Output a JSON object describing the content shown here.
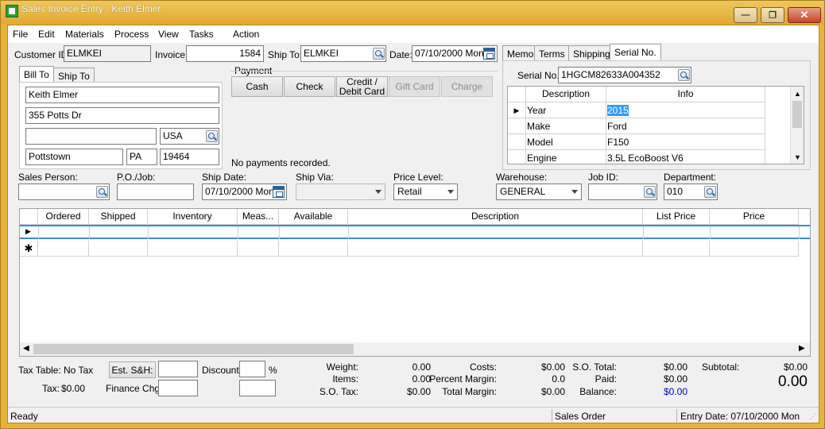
{
  "window": {
    "title": "Sales Invoice Entry - Keith Elmer"
  },
  "menu": [
    "File",
    "Edit",
    "Materials",
    "Process",
    "View",
    "Tasks",
    "Action"
  ],
  "header": {
    "customer_id_label": "Customer ID:",
    "customer_id": "ELMKEI",
    "invoice_label": "Invoice:",
    "invoice": "1584",
    "ship_to_label": "Ship To:",
    "ship_to": "ELMKEI",
    "date_label": "Date:",
    "date": "07/10/2000 Mon"
  },
  "address_tabs": [
    "Bill To",
    "Ship To"
  ],
  "bill_to": {
    "name": "Keith Elmer",
    "address1": "355 Potts Dr",
    "address2": "",
    "country": "USA",
    "city": "Pottstown",
    "state": "PA",
    "zip": "19464"
  },
  "payment": {
    "label": "Payment",
    "buttons": [
      "Cash",
      "Check",
      "Credit /\nDebit Card",
      "Gift Card",
      "Charge"
    ],
    "status": "No payments recorded."
  },
  "side_tabs": [
    "Memo",
    "Terms",
    "Shipping",
    "Serial No."
  ],
  "serial": {
    "label": "Serial No.",
    "value": "1HGCM82633A004352",
    "columns": [
      "Description",
      "Info"
    ],
    "rows": [
      {
        "desc": "Year",
        "info": "2015"
      },
      {
        "desc": "Make",
        "info": "Ford"
      },
      {
        "desc": "Model",
        "info": "F150"
      },
      {
        "desc": "Engine",
        "info": "3.5L EcoBoost V6"
      }
    ]
  },
  "order_fields": {
    "sales_person_label": "Sales Person:",
    "sales_person": "",
    "po_job_label": "P.O./Job:",
    "po_job": "",
    "ship_date_label": "Ship Date:",
    "ship_date": "07/10/2000 Mon",
    "ship_via_label": "Ship Via:",
    "ship_via": "",
    "price_level_label": "Price Level:",
    "price_level": "Retail",
    "warehouse_label": "Warehouse:",
    "warehouse": "GENERAL",
    "job_id_label": "Job ID:",
    "job_id": "",
    "department_label": "Department:",
    "department": "010"
  },
  "grid": {
    "columns": [
      "Ordered",
      "Shipped",
      "Inventory",
      "Meas...",
      "Available",
      "Description",
      "List Price",
      "Price"
    ]
  },
  "totals": {
    "tax_table_label": "Tax Table:",
    "tax_table": "No Tax",
    "tax_label": "Tax:",
    "tax": "$0.00",
    "est_sh_button": "Est. S&H:",
    "finance_chg_label": "Finance Chg:",
    "discount_label": "Discount:",
    "percent_sign": "%",
    "weight_label": "Weight:",
    "weight": "0.00",
    "items_label": "Items:",
    "items": "0.00",
    "so_tax_label": "S.O. Tax:",
    "so_tax": "$0.00",
    "costs_label": "Costs:",
    "costs": "$0.00",
    "percent_margin_label": "Percent Margin:",
    "percent_margin": "0.0",
    "total_margin_label": "Total Margin:",
    "total_margin": "$0.00",
    "so_total_label": "S.O. Total:",
    "so_total": "$0.00",
    "paid_label": "Paid:",
    "paid": "$0.00",
    "balance_label": "Balance:",
    "balance": "$0.00",
    "subtotal_label": "Subtotal:",
    "subtotal": "$0.00",
    "grand_total": "0.00"
  },
  "status": {
    "left": "Ready",
    "mode": "Sales Order",
    "entry_date": "Entry Date: 07/10/2000 Mon"
  },
  "colors": {
    "title_bar": "#e7b43a",
    "selection": "#3399ff",
    "balance": "#0000c0"
  }
}
